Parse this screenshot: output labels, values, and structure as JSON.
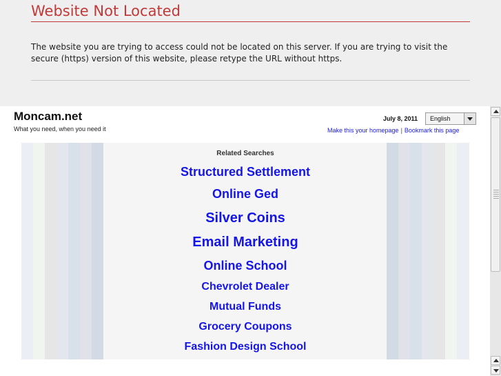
{
  "notice": {
    "title": "Website Not Located",
    "message": "The website you are trying to access could not be located on this server. If you are trying to visit the secure (https) version of this website, please retype the URL without https."
  },
  "site": {
    "name": "Moncam.net",
    "tagline": "What you need, when you need it",
    "date": "July 8, 2011",
    "language": "English",
    "make_homepage_link": "Make this your homepage",
    "separator": "|",
    "bookmark_link": "Bookmark this page"
  },
  "related": {
    "heading": "Related Searches",
    "items": [
      "Structured Settlement",
      "Online Ged",
      "Silver Coins",
      "Email Marketing",
      "Online School",
      "Chevrolet Dealer",
      "Mutual Funds",
      "Grocery Coupons",
      "Fashion Design School"
    ]
  },
  "colors": {
    "notice_red": "#c03a3a",
    "link_blue": "#1515e6",
    "stripe_palette": [
      "#e8eaf2",
      "#eef4ee",
      "#e2e2e2",
      "#dfe2ea",
      "#d5dde8",
      "#dcdde6",
      "#ced8e3"
    ]
  }
}
